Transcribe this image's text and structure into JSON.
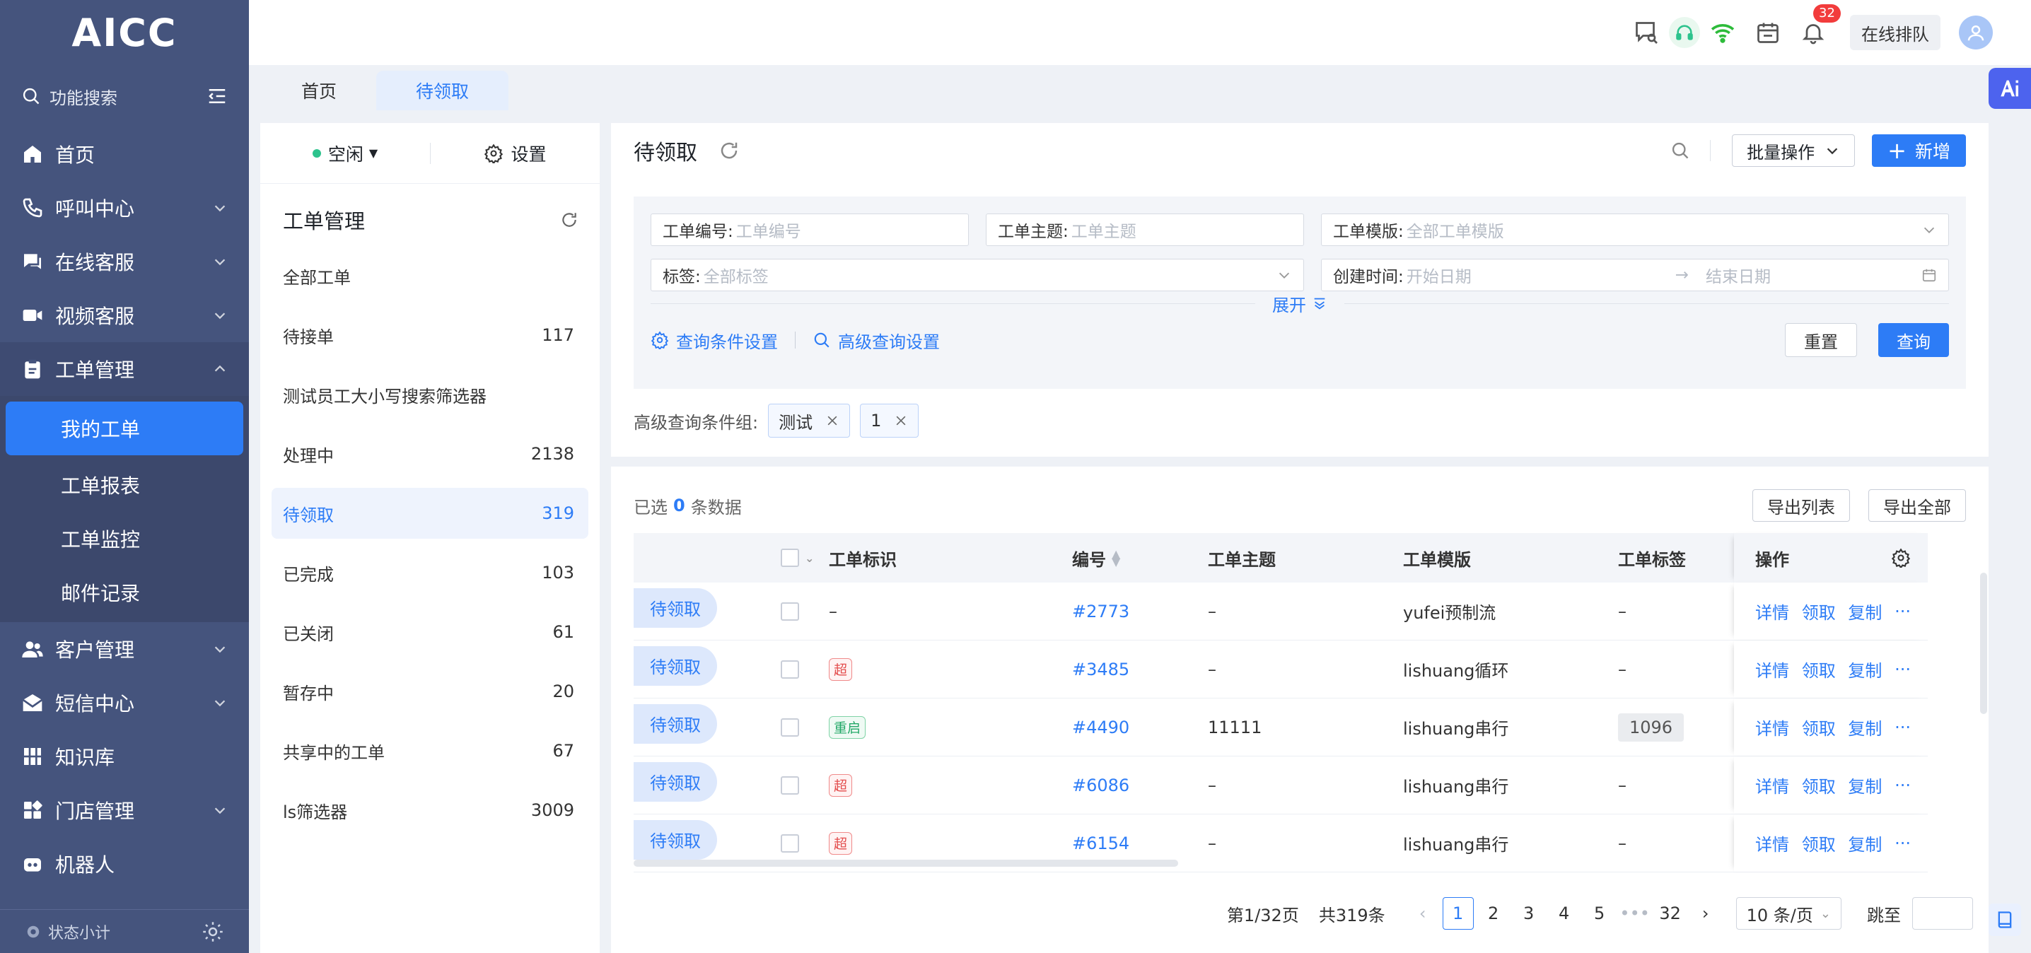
{
  "app": {
    "logo": "AICC"
  },
  "sidebar": {
    "search_label": "功能搜索",
    "items": [
      {
        "label": "首页",
        "icon": "home-icon"
      },
      {
        "label": "呼叫中心",
        "icon": "phone-icon"
      },
      {
        "label": "在线客服",
        "icon": "chat-icon"
      },
      {
        "label": "视频客服",
        "icon": "video-icon"
      },
      {
        "label": "工单管理",
        "icon": "clipboard-icon"
      },
      {
        "label": "客户管理",
        "icon": "users-icon"
      },
      {
        "label": "短信中心",
        "icon": "mail-icon"
      },
      {
        "label": "知识库",
        "icon": "grid-icon"
      },
      {
        "label": "门店管理",
        "icon": "store-icon"
      },
      {
        "label": "机器人",
        "icon": "robot-icon"
      }
    ],
    "submenu": [
      "我的工单",
      "工单报表",
      "工单监控",
      "邮件记录"
    ],
    "footer_label": "状态小计"
  },
  "topbar": {
    "bell_count": "32",
    "queue_label": "在线排队"
  },
  "tabs": [
    "首页",
    "待领取"
  ],
  "panel": {
    "status": "空闲",
    "settings": "设置",
    "title": "工单管理",
    "items": [
      {
        "label": "全部工单",
        "count": ""
      },
      {
        "label": "待接单",
        "count": "117"
      },
      {
        "label": "测试员工大小写搜索筛选器",
        "count": ""
      },
      {
        "label": "处理中",
        "count": "2138"
      },
      {
        "label": "待领取",
        "count": "319"
      },
      {
        "label": "已完成",
        "count": "103"
      },
      {
        "label": "已关闭",
        "count": "61"
      },
      {
        "label": "暂存中",
        "count": "20"
      },
      {
        "label": "共享中的工单",
        "count": "67"
      },
      {
        "label": "ls筛选器",
        "count": "3009"
      }
    ]
  },
  "main": {
    "title": "待领取",
    "batch": "批量操作",
    "new": "新增",
    "filters": {
      "no_label": "工单编号:",
      "no_ph": "工单编号",
      "subject_label": "工单主题:",
      "subject_ph": "工单主题",
      "template_label": "工单模版:",
      "template_ph": "全部工单模版",
      "tag_label": "标签:",
      "tag_ph": "全部标签",
      "time_label": "创建时间:",
      "start_ph": "开始日期",
      "end_ph": "结束日期",
      "expand": "展开",
      "cond_settings": "查询条件设置",
      "adv_settings": "高级查询设置",
      "reset": "重置",
      "query": "查询"
    },
    "adv_group_label": "高级查询条件组:",
    "adv_chips": [
      "测试",
      "1"
    ]
  },
  "table": {
    "selected_prefix": "已选",
    "selected_count": "0",
    "selected_suffix": "条数据",
    "export_list": "导出列表",
    "export_all": "导出全部",
    "headers": {
      "mark": "工单标识",
      "no": "编号",
      "subject": "工单主题",
      "template": "工单模版",
      "tags": "工单标签",
      "ops": "操作"
    },
    "ops": {
      "detail": "详情",
      "claim": "领取",
      "copy": "复制",
      "more": "···"
    },
    "rows": [
      {
        "status": "待领取",
        "mark": "–",
        "mark_type": "text",
        "no": "#2773",
        "subject": "–",
        "template": "yufei预制流",
        "tags": "–"
      },
      {
        "status": "待领取",
        "mark": "超",
        "mark_type": "red",
        "no": "#3485",
        "subject": "–",
        "template": "lishuang循环",
        "tags": "–"
      },
      {
        "status": "待领取",
        "mark": "重启",
        "mark_type": "green",
        "no": "#4490",
        "subject": "11111",
        "template": "lishuang串行",
        "tags": "1096"
      },
      {
        "status": "待领取",
        "mark": "超",
        "mark_type": "red",
        "no": "#6086",
        "subject": "–",
        "template": "lishuang串行",
        "tags": "–"
      },
      {
        "status": "待领取",
        "mark": "超",
        "mark_type": "red",
        "no": "#6154",
        "subject": "–",
        "template": "lishuang串行",
        "tags": "–"
      }
    ]
  },
  "pager": {
    "page_info": "第1/32页",
    "total": "共319条",
    "pages": [
      "1",
      "2",
      "3",
      "4",
      "5",
      "•••",
      "32"
    ],
    "per_page": "10 条/页",
    "jump": "跳至"
  }
}
